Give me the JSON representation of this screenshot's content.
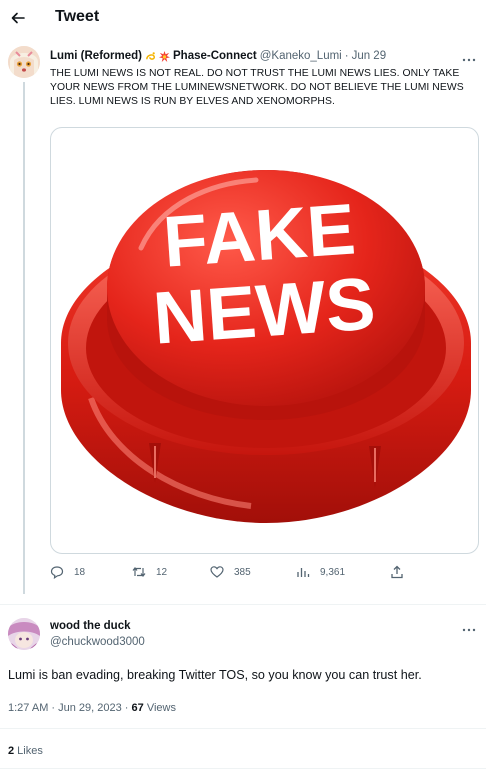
{
  "header": {
    "title": "Tweet",
    "back_icon": "arrow-left-icon"
  },
  "main_tweet": {
    "display_name": "Lumi (Reformed)",
    "display_name_suffix": "Phase-Connect",
    "name_emojis": [
      "dizzy-emoji",
      "collision-emoji"
    ],
    "handle": "@Kaneko_Lumi",
    "separator": "·",
    "date": "Jun 29",
    "text": "THE LUMI NEWS IS NOT REAL. DO NOT TRUST THE LUMI NEWS LIES. ONLY TAKE YOUR NEWS FROM THE LUMINEWSNETWORK. DO NOT BELIEVE THE LUMI NEWS LIES. LUMI NEWS IS RUN BY ELVES AND XENOMORPHS.",
    "image": {
      "line1": "FAKE",
      "line2": "NEWS"
    },
    "stats": {
      "replies": "18",
      "retweets": "12",
      "likes": "385",
      "views": "9,361"
    }
  },
  "reply_tweet": {
    "display_name": "wood the duck",
    "handle": "@chuckwood3000",
    "text": "Lumi is ban evading, breaking Twitter TOS, so you know you can trust her.",
    "timestamp": "1:27 AM · Jun 29, 2023 · ",
    "views_count": "67",
    "views_label": " Views",
    "likes_count": "2",
    "likes_label": " Likes"
  },
  "colors": {
    "text_primary": "#0f1419",
    "text_secondary": "#536471",
    "border": "#cfd9de",
    "button_red": "#e2231a"
  }
}
